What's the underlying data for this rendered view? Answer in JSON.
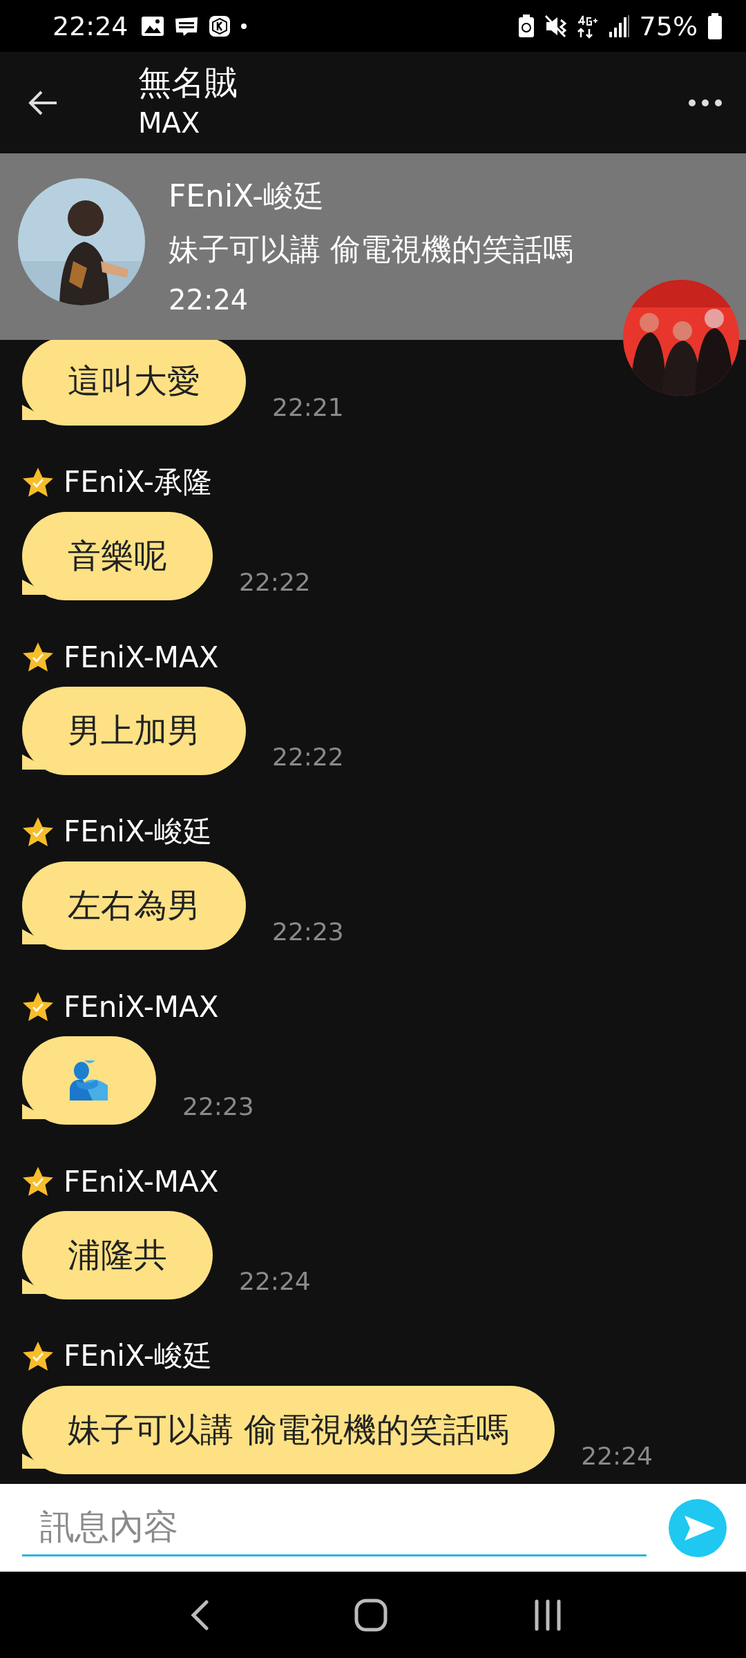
{
  "status_bar": {
    "time": "22:24",
    "battery": "75%"
  },
  "header": {
    "title": "無名賊",
    "subtitle": "MAX"
  },
  "notification": {
    "sender": "FEniX-峻廷",
    "text": "妹子可以講 偷電視機的笑話嗎",
    "time": "22:24"
  },
  "messages": [
    {
      "kind": "text",
      "text": "這叫大愛",
      "time": "22:21"
    },
    {
      "sender": "FEniX-承隆",
      "kind": "text",
      "text": "音樂呢",
      "time": "22:22"
    },
    {
      "sender": "FEniX-MAX",
      "kind": "text",
      "text": "男上加男",
      "time": "22:22"
    },
    {
      "sender": "FEniX-峻廷",
      "kind": "text",
      "text": "左右為男",
      "time": "22:23"
    },
    {
      "sender": "FEniX-MAX",
      "kind": "emoji",
      "time": "22:23"
    },
    {
      "sender": "FEniX-MAX",
      "kind": "text",
      "text": "浦隆共",
      "time": "22:24"
    },
    {
      "sender": "FEniX-峻廷",
      "kind": "text",
      "text": "妹子可以講 偷電視機的笑話嗎",
      "time": "22:24"
    }
  ],
  "composer": {
    "placeholder": "訊息內容"
  }
}
